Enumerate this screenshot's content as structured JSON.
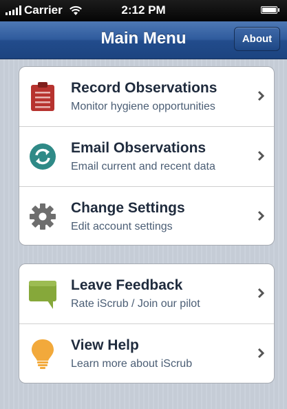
{
  "status_bar": {
    "carrier": "Carrier",
    "time": "2:12 PM"
  },
  "nav_bar": {
    "title": "Main Menu",
    "about_label": "About"
  },
  "menu": {
    "groups": [
      {
        "items": [
          {
            "title": "Record Observations",
            "subtitle": "Monitor hygiene opportunities",
            "icon": "clipboard-icon",
            "color": "#b7332f"
          },
          {
            "title": "Email Observations",
            "subtitle": "Email current and recent data",
            "icon": "sync-icon",
            "color": "#2f8a87"
          },
          {
            "title": "Change Settings",
            "subtitle": "Edit account settings",
            "icon": "gear-icon",
            "color": "#6e6e6e"
          }
        ]
      },
      {
        "items": [
          {
            "title": "Leave Feedback",
            "subtitle": "Rate iScrub / Join our pilot",
            "icon": "speech-bubble-icon",
            "color": "#86a83a"
          },
          {
            "title": "View Help",
            "subtitle": "Learn more about iScrub",
            "icon": "lightbulb-icon",
            "color": "#f2a93b"
          }
        ]
      }
    ]
  }
}
